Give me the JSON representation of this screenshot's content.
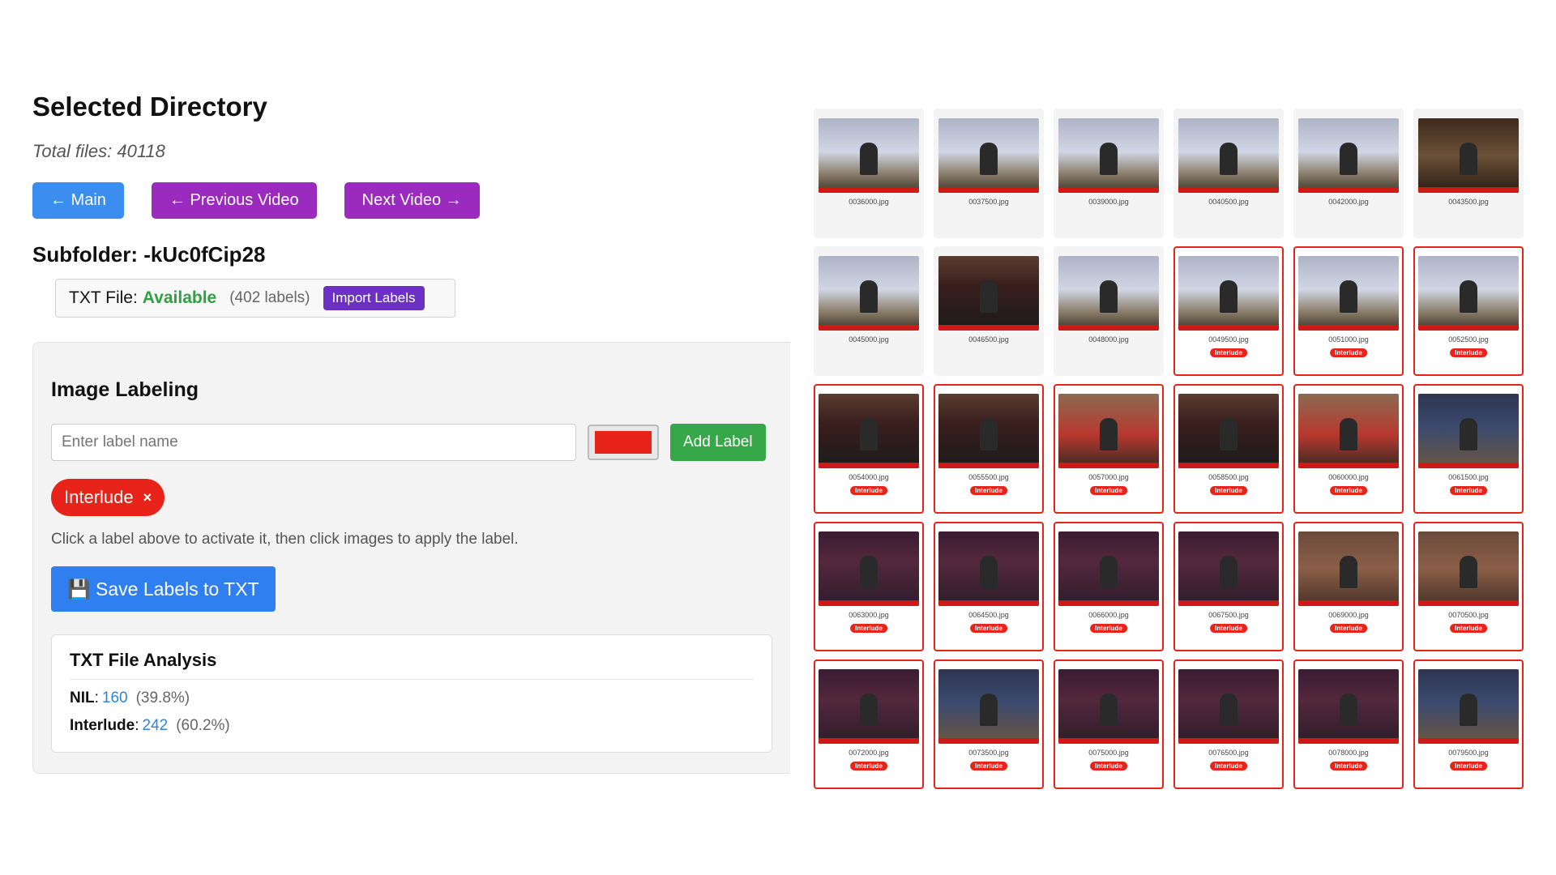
{
  "header": {
    "title": "Selected Directory",
    "total_files": "Total files: 40118"
  },
  "nav": {
    "main": "← Main",
    "previous": "← Previous Video",
    "next": "Next Video →"
  },
  "subfolder": "Subfolder: -kUc0fCip28",
  "txt_file": {
    "prefix": "TXT File:",
    "status": "Available",
    "count": "(402 labels)",
    "import_label": "Import Labels"
  },
  "labeling": {
    "title": "Image Labeling",
    "input_placeholder": "Enter label name",
    "color_value": "#e8231a",
    "add_label": "Add Label",
    "labels": [
      {
        "name": "Interlude",
        "color": "#e8231a",
        "remove": "×"
      }
    ],
    "hint": "Click a label above to activate it, then click images to apply the label.",
    "save_label": "💾 Save Labels to TXT"
  },
  "analysis": {
    "title": "TXT File Analysis",
    "rows": [
      {
        "key": "NIL",
        "value": "160",
        "pct": "(39.8%)"
      },
      {
        "key": "Interlude",
        "value": "242",
        "pct": "(60.2%)"
      }
    ]
  },
  "images": [
    {
      "file": "0036000.jpg",
      "label": null,
      "scene": "shadow"
    },
    {
      "file": "0037500.jpg",
      "label": null,
      "scene": "shadow"
    },
    {
      "file": "0039000.jpg",
      "label": null,
      "scene": "shadow"
    },
    {
      "file": "0040500.jpg",
      "label": null,
      "scene": "shadow"
    },
    {
      "file": "0042000.jpg",
      "label": null,
      "scene": "shadow"
    },
    {
      "file": "0043500.jpg",
      "label": null,
      "scene": "wayang"
    },
    {
      "file": "0045000.jpg",
      "label": null,
      "scene": "shadow"
    },
    {
      "file": "0046500.jpg",
      "label": null,
      "scene": "singer"
    },
    {
      "file": "0048000.jpg",
      "label": null,
      "scene": "shadow"
    },
    {
      "file": "0049500.jpg",
      "label": "Interlude",
      "scene": "shadow"
    },
    {
      "file": "0051000.jpg",
      "label": "Interlude",
      "scene": "shadow"
    },
    {
      "file": "0052500.jpg",
      "label": "Interlude",
      "scene": "shadow"
    },
    {
      "file": "0054000.jpg",
      "label": "Interlude",
      "scene": "singer"
    },
    {
      "file": "0055500.jpg",
      "label": "Interlude",
      "scene": "singer"
    },
    {
      "file": "0057000.jpg",
      "label": "Interlude",
      "scene": "red"
    },
    {
      "file": "0058500.jpg",
      "label": "Interlude",
      "scene": "singer"
    },
    {
      "file": "0060000.jpg",
      "label": "Interlude",
      "scene": "red"
    },
    {
      "file": "0061500.jpg",
      "label": "Interlude",
      "scene": "blue"
    },
    {
      "file": "0063000.jpg",
      "label": "Interlude",
      "scene": "stage"
    },
    {
      "file": "0064500.jpg",
      "label": "Interlude",
      "scene": "stage"
    },
    {
      "file": "0066000.jpg",
      "label": "Interlude",
      "scene": "stage"
    },
    {
      "file": "0067500.jpg",
      "label": "Interlude",
      "scene": "stage"
    },
    {
      "file": "0069000.jpg",
      "label": "Interlude",
      "scene": "crowd"
    },
    {
      "file": "0070500.jpg",
      "label": "Interlude",
      "scene": "crowd"
    },
    {
      "file": "0072000.jpg",
      "label": "Interlude",
      "scene": "stage"
    },
    {
      "file": "0073500.jpg",
      "label": "Interlude",
      "scene": "blue"
    },
    {
      "file": "0075000.jpg",
      "label": "Interlude",
      "scene": "stage"
    },
    {
      "file": "0076500.jpg",
      "label": "Interlude",
      "scene": "stage"
    },
    {
      "file": "0078000.jpg",
      "label": "Interlude",
      "scene": "stage"
    },
    {
      "file": "0079500.jpg",
      "label": "Interlude",
      "scene": "blue"
    }
  ]
}
